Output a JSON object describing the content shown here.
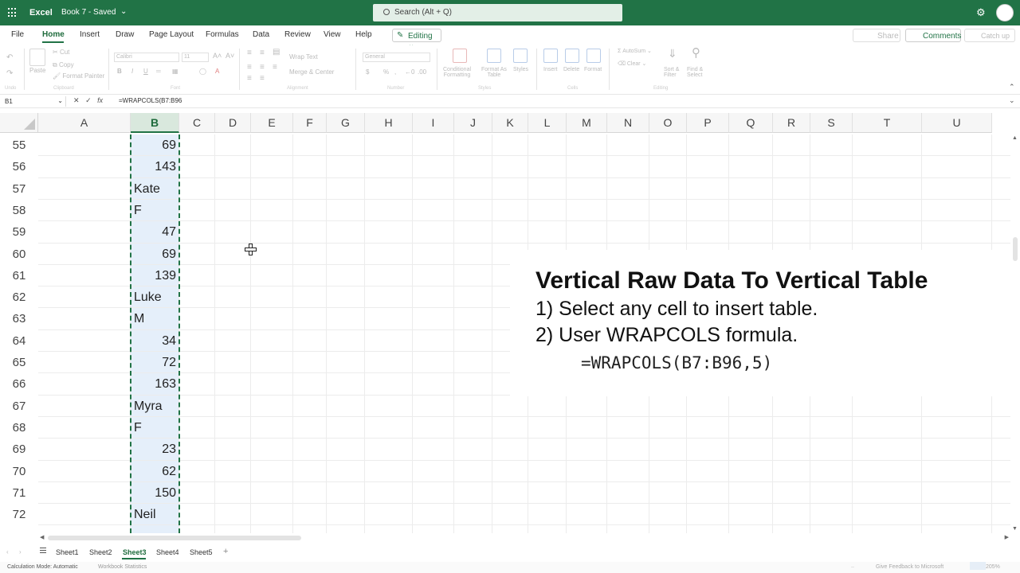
{
  "titlebar": {
    "app_name": "Excel",
    "doc_title": "Book 7 - Saved",
    "search_placeholder": "Search (Alt + Q)",
    "colors": {
      "brand": "#217346"
    }
  },
  "menu": {
    "tabs": [
      "File",
      "Home",
      "Insert",
      "Draw",
      "Page Layout",
      "Formulas",
      "Data",
      "Review",
      "View",
      "Help"
    ],
    "active_tab": "Home",
    "editing_label": "Editing",
    "share_label": "Share",
    "comments_label": "Comments",
    "catchup_label": "Catch up"
  },
  "ribbon": {
    "undo_group": "Undo",
    "clipboard": {
      "paste": "Paste",
      "cut": "Cut",
      "copy": "Copy",
      "format_painter": "Format Painter",
      "group": "Clipboard"
    },
    "font": {
      "name": "Calibri",
      "size": "11",
      "bold": "B",
      "italic": "I",
      "underline": "U",
      "group": "Font"
    },
    "alignment": {
      "wrap_text": "Wrap Text",
      "merge_center": "Merge & Center",
      "group": "Alignment"
    },
    "number": {
      "format": "General",
      "currency": "$",
      "percent": "%",
      "group": "Number"
    },
    "styles": {
      "conditional": "Conditional\nFormatting",
      "format_as_table": "Format As\nTable",
      "styles": "Styles",
      "group": "Styles"
    },
    "cells": {
      "insert": "Insert",
      "delete": "Delete",
      "format": "Format",
      "group": "Cells"
    },
    "editing": {
      "autosum": "AutoSum",
      "clear": "Clear",
      "sort_filter": "Sort &\nFilter",
      "find_select": "Find &\nSelect",
      "group": "Editing"
    }
  },
  "formula_bar": {
    "name_box": "B1",
    "formula": "=WRAPCOLS(B7:B96"
  },
  "grid": {
    "columns": [
      "A",
      "B",
      "C",
      "D",
      "E",
      "F",
      "G",
      "H",
      "I",
      "J",
      "K",
      "L",
      "M",
      "N",
      "O",
      "P",
      "Q",
      "R",
      "S",
      "T",
      "U"
    ],
    "selected_column": "B",
    "rows": [
      {
        "n": "55",
        "b": "69",
        "num": true
      },
      {
        "n": "56",
        "b": "143",
        "num": true
      },
      {
        "n": "57",
        "b": "Kate",
        "num": false
      },
      {
        "n": "58",
        "b": "F",
        "num": false
      },
      {
        "n": "59",
        "b": "47",
        "num": true
      },
      {
        "n": "60",
        "b": "69",
        "num": true
      },
      {
        "n": "61",
        "b": "139",
        "num": true
      },
      {
        "n": "62",
        "b": "Luke",
        "num": false
      },
      {
        "n": "63",
        "b": "M",
        "num": false
      },
      {
        "n": "64",
        "b": "34",
        "num": true
      },
      {
        "n": "65",
        "b": "72",
        "num": true
      },
      {
        "n": "66",
        "b": "163",
        "num": true
      },
      {
        "n": "67",
        "b": "Myra",
        "num": false
      },
      {
        "n": "68",
        "b": "F",
        "num": false
      },
      {
        "n": "69",
        "b": "23",
        "num": true
      },
      {
        "n": "70",
        "b": "62",
        "num": true
      },
      {
        "n": "71",
        "b": "150",
        "num": true
      },
      {
        "n": "72",
        "b": "Neil",
        "num": false
      }
    ]
  },
  "overlay": {
    "title": "Vertical Raw Data To Vertical Table",
    "step1": "1) Select any cell to insert table.",
    "step2": "2) User WRAPCOLS formula.",
    "formula": "=WRAPCOLS(B7:B96,5)"
  },
  "sheets": {
    "tabs": [
      "Sheet1",
      "Sheet2",
      "Sheet3",
      "Sheet4",
      "Sheet5"
    ],
    "active": "Sheet3",
    "add_label": "+"
  },
  "status": {
    "calc_mode": "Calculation Mode: Automatic",
    "workbook_stats": "Workbook Statistics",
    "feedback": "Give Feedback to Microsoft",
    "zoom": "205%"
  }
}
